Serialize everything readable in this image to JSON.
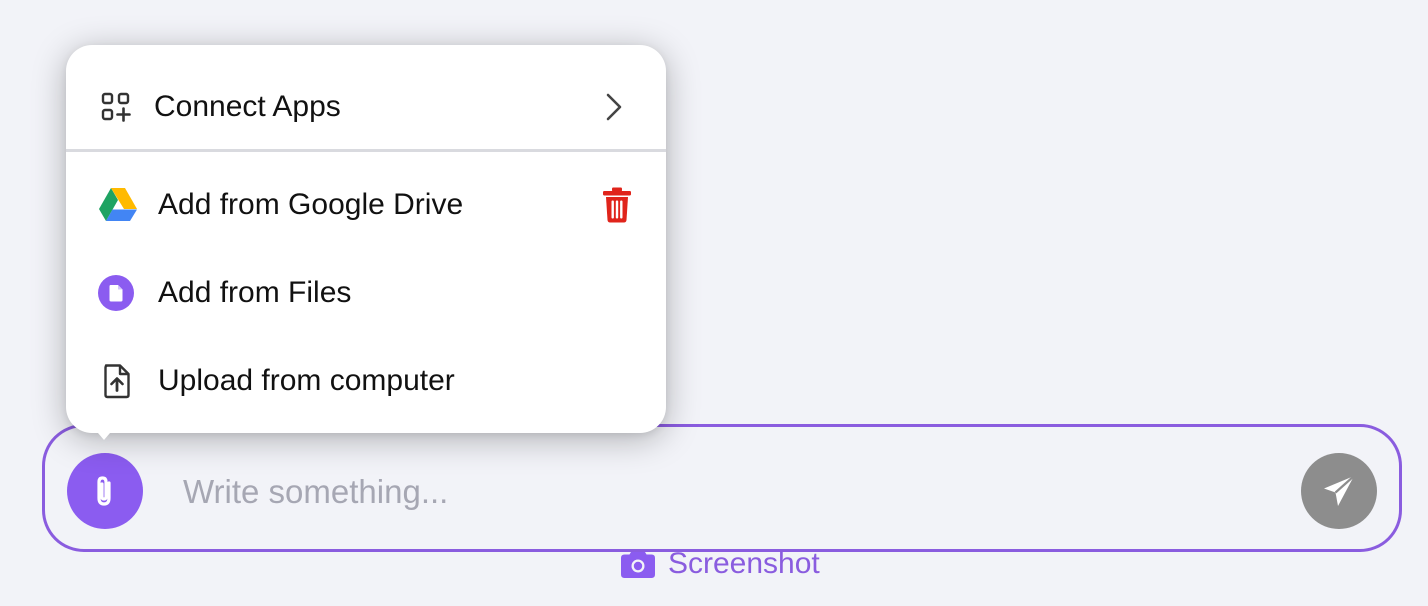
{
  "menu": {
    "connect_apps": {
      "label": "Connect Apps",
      "icon": "apps-add-icon",
      "trailing_icon": "chevron-right-icon"
    },
    "items": [
      {
        "label": "Add from Google Drive",
        "icon": "google-drive-icon",
        "trailing_icon": "trash-icon"
      },
      {
        "label": "Add from Files",
        "icon": "file-circle-icon"
      },
      {
        "label": "Upload from computer",
        "icon": "file-upload-icon"
      }
    ]
  },
  "composer": {
    "placeholder": "Write something...",
    "value": "",
    "attach_icon": "paperclip-icon",
    "send_icon": "send-icon"
  },
  "screenshot": {
    "label": "Screenshot",
    "icon": "camera-icon"
  },
  "colors": {
    "accent": "#8b5cf0",
    "border": "#8a5cdf",
    "trash": "#e0241b",
    "send_bg": "#8d8d8d",
    "background": "#f2f3f8"
  }
}
